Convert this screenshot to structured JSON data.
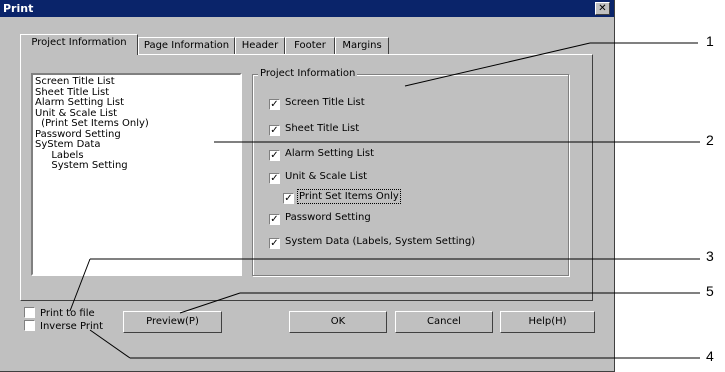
{
  "window": {
    "title": "Print",
    "close_glyph": "✕"
  },
  "tabs": [
    {
      "label": "Project Information"
    },
    {
      "label": "Page Information"
    },
    {
      "label": "Header"
    },
    {
      "label": "Footer"
    },
    {
      "label": "Margins"
    }
  ],
  "list": [
    "Screen Title List",
    "Sheet Title List",
    "Alarm Setting List",
    "Unit & Scale List",
    " (Print Set Items Only)",
    "Password Setting",
    "SyStem Data",
    "  Labels",
    "  System Setting"
  ],
  "group": {
    "title": "Project Information",
    "checks": [
      {
        "label": "Screen Title List",
        "checked": true
      },
      {
        "label": "Sheet Title List",
        "checked": true
      },
      {
        "label": "Alarm Setting List",
        "checked": true
      },
      {
        "label": "Unit & Scale List",
        "checked": true
      },
      {
        "label": "Print Set Items Only",
        "checked": true
      },
      {
        "label": "Password Setting",
        "checked": true
      },
      {
        "label": "System Data (Labels, System Setting)",
        "checked": true
      }
    ]
  },
  "bottom": {
    "print_to_file": "Print to file",
    "inverse_print": "Inverse Print",
    "preview": "Preview(P)",
    "ok": "OK",
    "cancel": "Cancel",
    "help": "Help(H)"
  },
  "callouts": [
    "1",
    "2",
    "3",
    "4",
    "5"
  ]
}
